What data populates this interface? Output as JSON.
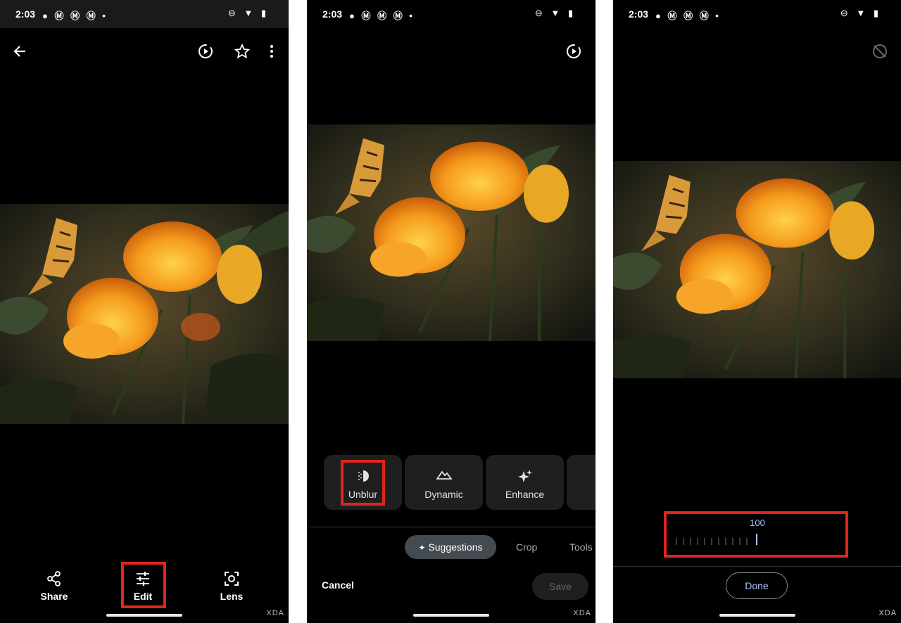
{
  "status_bar": {
    "time": "2:03",
    "left_icons": "● Ⓜ Ⓜ Ⓜ •",
    "right_icons": "⊖ ▼ ▮"
  },
  "panel1": {
    "actions": [
      {
        "label": "Share",
        "icon": "share-icon"
      },
      {
        "label": "Edit",
        "icon": "sliders-icon"
      },
      {
        "label": "Lens",
        "icon": "lens-icon"
      }
    ]
  },
  "panel2": {
    "suggestions": [
      {
        "label": "Unblur",
        "icon": "unblur-icon"
      },
      {
        "label": "Dynamic",
        "icon": "mountain-icon"
      },
      {
        "label": "Enhance",
        "icon": "sparkle-icon"
      }
    ],
    "tabs": {
      "suggestions": "Suggestions",
      "crop": "Crop",
      "tools": "Tools"
    },
    "cancel": "Cancel",
    "save": "Save"
  },
  "panel3": {
    "slider_value": "100",
    "done": "Done"
  },
  "watermark": "XDA",
  "colors": {
    "highlight": "#e0261b",
    "chip": "#444b50",
    "accent": "#a8c7fa"
  }
}
